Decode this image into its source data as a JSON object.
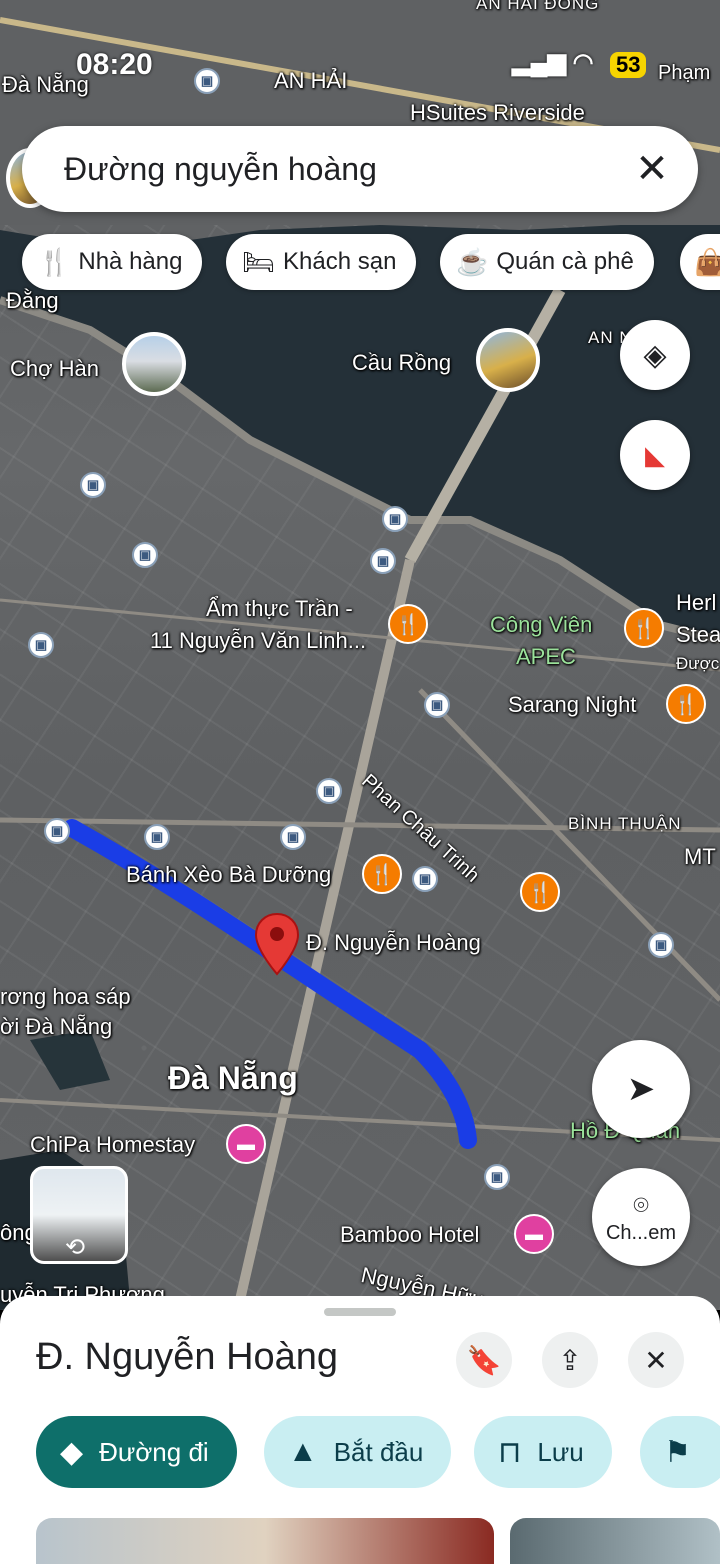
{
  "status_bar": {
    "time": "08:20",
    "battery": "53"
  },
  "search": {
    "query": "Đường nguyễn hoàng"
  },
  "chips": [
    {
      "label": "Nhà hàng",
      "icon": "restaurant-icon"
    },
    {
      "label": "Khách sạn",
      "icon": "hotel-icon"
    },
    {
      "label": "Quán cà phê",
      "icon": "coffee-icon"
    }
  ],
  "map": {
    "labels": {
      "da_nang_top": "Đà Nẵng",
      "an_hai": "AN HẢI",
      "an_hai_dong": "AN HẢI ĐÔNG",
      "hsuites": "HSuites Riverside",
      "pham": "Phạm",
      "dang": "Đằng",
      "cho_han": "Chợ Hàn",
      "cau_rong": "Cầu Rồng",
      "an_ny": "AN N    Y",
      "am_thuc_1": "Ẩm thực Trần -",
      "am_thuc_2": "11 Nguyễn Văn Linh...",
      "cong_vien_1": "Công Viên",
      "cong_vien_2": "APEC",
      "herb_1": "Herl",
      "herb_2": "Stea",
      "herb_3": "Được",
      "sarang": "Sarang Night",
      "phan_chau_trinh": "Phan Châu Trinh",
      "binh_thuan": "BÌNH THUẬN",
      "mt": "MT",
      "banh_xeo": "Bánh Xèo Bà Dưỡng",
      "nguyen_hoang": "Đ. Nguyễn Hoàng",
      "hoa_sap_1": "rơng hoa sáp",
      "hoa_sap_2": "ời Đà Nẵng",
      "da_nang_center": "Đà Nẵng",
      "chipa": "ChiPa Homestay",
      "ho_dan": "Hồ Đ    Quân",
      "bamboo": "Bamboo Hotel",
      "nguyen_huu": "Nguyễn Hữu",
      "ong": "ông",
      "tri_phuong": "uyễn Tri Phương"
    },
    "camera_button_label": "Ch...em"
  },
  "sheet": {
    "title": "Đ. Nguyễn Hoàng",
    "actions": [
      {
        "label": "Đường đi",
        "icon": "directions-icon"
      },
      {
        "label": "Bắt đầu",
        "icon": "navigation-arrow-icon"
      },
      {
        "label": "Lưu",
        "icon": "bookmark-icon"
      }
    ]
  }
}
